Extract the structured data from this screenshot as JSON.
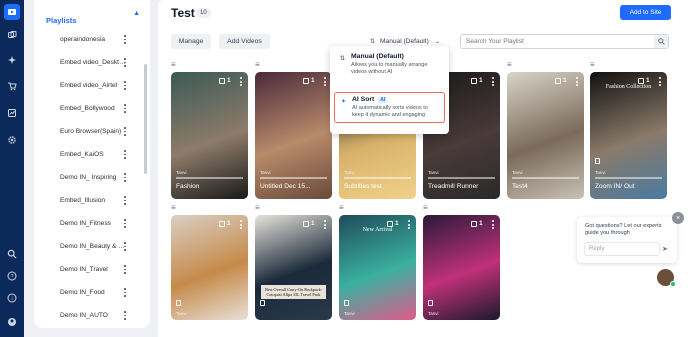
{
  "rail": {
    "items": [
      {
        "name": "playlist-icon",
        "active": true
      },
      {
        "name": "stories-icon",
        "active": false
      },
      {
        "name": "sparkle-icon",
        "active": false
      },
      {
        "name": "cart-icon",
        "active": false
      },
      {
        "name": "analytics-icon",
        "active": false
      },
      {
        "name": "settings-icon",
        "active": false
      },
      {
        "name": "search-icon",
        "active": false
      },
      {
        "name": "help-icon",
        "active": false
      },
      {
        "name": "info-icon",
        "active": false
      },
      {
        "name": "profile-icon",
        "active": false
      }
    ]
  },
  "sidebar": {
    "title": "Playlists",
    "items": [
      {
        "label": "operaindonesia"
      },
      {
        "label": "Embed video_Desktop"
      },
      {
        "label": "Embed video_Airtel"
      },
      {
        "label": "Embed_Bollywood"
      },
      {
        "label": "Euro Browser(Spain)"
      },
      {
        "label": "Embed_KaiOS"
      },
      {
        "label": "Demo IN_ Inspiring"
      },
      {
        "label": "Embed_Illusion"
      },
      {
        "label": "Demo IN_Fitness"
      },
      {
        "label": "Demo IN_Beauty & More"
      },
      {
        "label": "Demo IN_Travel"
      },
      {
        "label": "Demo IN_Food"
      },
      {
        "label": "Demo IN_AUTO"
      }
    ]
  },
  "header": {
    "title": "Test",
    "count": "10",
    "add_to_site": "Add to Site",
    "manage": "Manage",
    "add_videos": "Add Videos",
    "sort_label": "Manual (Default)",
    "search_placeholder": "Search Your Playlist"
  },
  "dropdown": {
    "options": [
      {
        "title": "Manual (Default)",
        "desc": "Allows you to manually arrange videos without AI",
        "selected": false
      },
      {
        "title": "AI Sort",
        "badge": "AI",
        "desc": "AI automatically sorts videos to keep it dynamic and engaging",
        "selected": true
      }
    ]
  },
  "videos": [
    {
      "title": "Fashion",
      "author": "Tanvi",
      "products": "1",
      "colors": [
        "#3b5a55",
        "#8c7b6a",
        "#1a1a1a"
      ],
      "overlay": ""
    },
    {
      "title": "Untitled Dec 15...",
      "author": "Tanvi",
      "products": "1",
      "colors": [
        "#4a2a3a",
        "#b88a6a",
        "#6a4a3a"
      ],
      "overlay": ""
    },
    {
      "title": "Subtitles test",
      "author": "Tanvi",
      "products": "1",
      "colors": [
        "#2b2b2b",
        "#d9b26a",
        "#f0d28a"
      ],
      "overlay": ""
    },
    {
      "title": "Treadmill Runner",
      "author": "Tanvi",
      "products": "1",
      "colors": [
        "#1a1a1a",
        "#4a3a3a",
        "#2a2a2a"
      ],
      "overlay": ""
    },
    {
      "title": "Test4",
      "author": "Tanvi",
      "products": "1",
      "colors": [
        "#d9d4c9",
        "#7a6a5a",
        "#c9c2b5"
      ],
      "overlay": ""
    },
    {
      "title": "Zoom IN/ Out",
      "author": "Tanvi",
      "products": "1",
      "colors": [
        "#111111",
        "#8a7a6a",
        "#4a7aa0"
      ],
      "overlay": "Fashion Collection"
    },
    {
      "title": "",
      "author": "Tanvi",
      "products": "1",
      "colors": [
        "#d9cfc4",
        "#c68a4a",
        "#e8e0d8"
      ],
      "overlay": ""
    },
    {
      "title": "",
      "author": "",
      "products": "1",
      "colors": [
        "#e8e4dc",
        "#1a2a3a",
        "#2a3a4a"
      ],
      "overlay": "Best Overall Carry-On Backpack: Cotopaxi Allpa 35L Travel Pack"
    },
    {
      "title": "",
      "author": "Tanvi",
      "products": "1",
      "colors": [
        "#1f4b5a",
        "#3ab0a0",
        "#e05a8a"
      ],
      "overlay": "New Arrival"
    },
    {
      "title": "",
      "author": "Tanvi",
      "products": "1",
      "colors": [
        "#2a1a3a",
        "#c0307a",
        "#1a1a2a"
      ],
      "overlay": ""
    }
  ],
  "chat": {
    "message": "Got questions? Let our experts guide you through",
    "reply_placeholder": "Reply"
  }
}
